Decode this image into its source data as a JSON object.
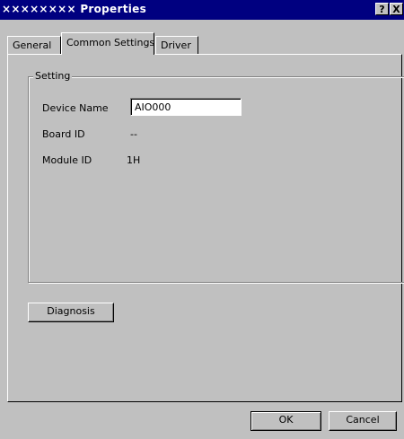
{
  "window": {
    "title": "×××××××× Properties",
    "help_glyph": "?",
    "close_glyph": "X"
  },
  "tabs": [
    {
      "label": "General",
      "selected": false
    },
    {
      "label": "Common Settings",
      "selected": true
    },
    {
      "label": "Driver",
      "selected": false
    }
  ],
  "setting": {
    "group_title": "Setting",
    "device_name_label": "Device Name",
    "device_name_value": "AIO000",
    "board_id_label": "Board ID",
    "board_id_value": "--",
    "module_id_label": "Module ID",
    "module_id_value": "1H"
  },
  "buttons": {
    "diagnosis": "Diagnosis",
    "ok": "OK",
    "cancel": "Cancel"
  }
}
